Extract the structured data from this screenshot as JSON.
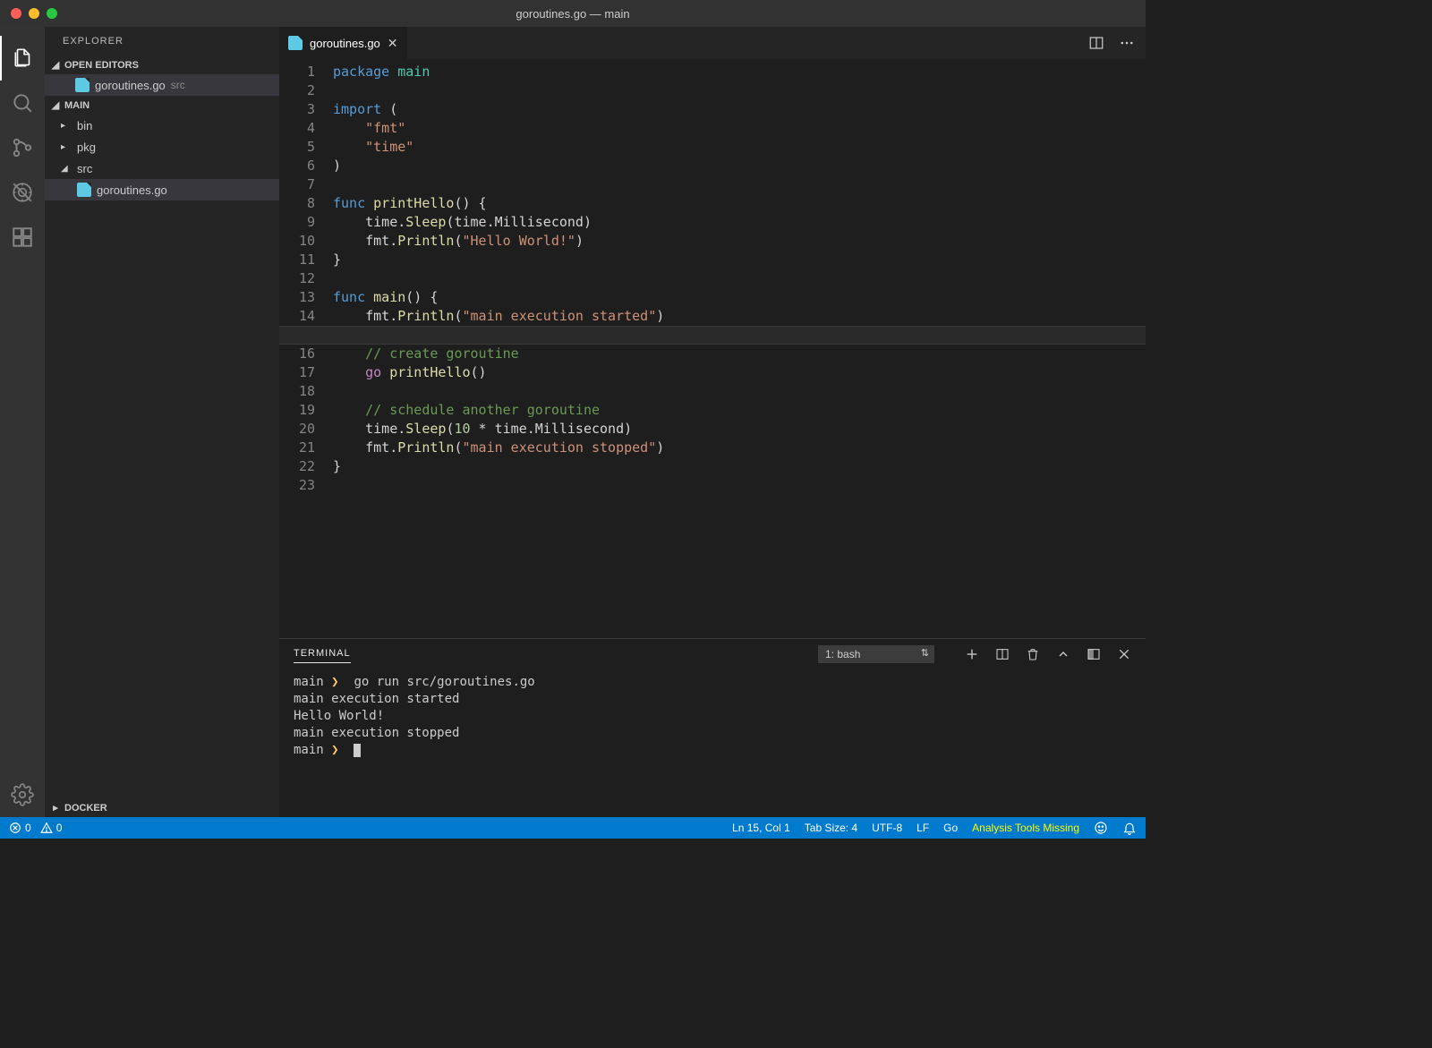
{
  "window": {
    "title": "goroutines.go — main"
  },
  "sidebar": {
    "title": "EXPLORER",
    "open_editors_label": "OPEN EDITORS",
    "open_editors": [
      {
        "name": "goroutines.go",
        "hint": "src"
      }
    ],
    "workspace_label": "MAIN",
    "tree": {
      "bin": "bin",
      "pkg": "pkg",
      "src": "src",
      "file": "goroutines.go"
    },
    "docker_label": "DOCKER"
  },
  "tabs": [
    {
      "name": "goroutines.go"
    }
  ],
  "code": {
    "lines": [
      [
        {
          "c": "kw",
          "t": "package"
        },
        {
          "c": "pl",
          "t": " "
        },
        {
          "c": "pkg",
          "t": "main"
        }
      ],
      [],
      [
        {
          "c": "kw",
          "t": "import"
        },
        {
          "c": "pl",
          "t": " ("
        }
      ],
      [
        {
          "c": "pl",
          "t": "    "
        },
        {
          "c": "str",
          "t": "\"fmt\""
        }
      ],
      [
        {
          "c": "pl",
          "t": "    "
        },
        {
          "c": "str",
          "t": "\"time\""
        }
      ],
      [
        {
          "c": "pl",
          "t": ")"
        }
      ],
      [],
      [
        {
          "c": "kw",
          "t": "func"
        },
        {
          "c": "pl",
          "t": " "
        },
        {
          "c": "fn",
          "t": "printHello"
        },
        {
          "c": "pl",
          "t": "() {"
        }
      ],
      [
        {
          "c": "pl",
          "t": "    time."
        },
        {
          "c": "fn",
          "t": "Sleep"
        },
        {
          "c": "pl",
          "t": "(time.Millisecond)"
        }
      ],
      [
        {
          "c": "pl",
          "t": "    fmt."
        },
        {
          "c": "fn",
          "t": "Println"
        },
        {
          "c": "pl",
          "t": "("
        },
        {
          "c": "str",
          "t": "\"Hello World!\""
        },
        {
          "c": "pl",
          "t": ")"
        }
      ],
      [
        {
          "c": "pl",
          "t": "}"
        }
      ],
      [],
      [
        {
          "c": "kw",
          "t": "func"
        },
        {
          "c": "pl",
          "t": " "
        },
        {
          "c": "fn",
          "t": "main"
        },
        {
          "c": "pl",
          "t": "() {"
        }
      ],
      [
        {
          "c": "pl",
          "t": "    fmt."
        },
        {
          "c": "fn",
          "t": "Println"
        },
        {
          "c": "pl",
          "t": "("
        },
        {
          "c": "str",
          "t": "\"main execution started\""
        },
        {
          "c": "pl",
          "t": ")"
        }
      ],
      [],
      [
        {
          "c": "pl",
          "t": "    "
        },
        {
          "c": "cm",
          "t": "// create goroutine"
        }
      ],
      [
        {
          "c": "pl",
          "t": "    "
        },
        {
          "c": "ctrl",
          "t": "go"
        },
        {
          "c": "pl",
          "t": " "
        },
        {
          "c": "fn",
          "t": "printHello"
        },
        {
          "c": "pl",
          "t": "()"
        }
      ],
      [],
      [
        {
          "c": "pl",
          "t": "    "
        },
        {
          "c": "cm",
          "t": "// schedule another goroutine"
        }
      ],
      [
        {
          "c": "pl",
          "t": "    time."
        },
        {
          "c": "fn",
          "t": "Sleep"
        },
        {
          "c": "pl",
          "t": "("
        },
        {
          "c": "num",
          "t": "10"
        },
        {
          "c": "pl",
          "t": " * time.Millisecond)"
        }
      ],
      [
        {
          "c": "pl",
          "t": "    fmt."
        },
        {
          "c": "fn",
          "t": "Println"
        },
        {
          "c": "pl",
          "t": "("
        },
        {
          "c": "str",
          "t": "\"main execution stopped\""
        },
        {
          "c": "pl",
          "t": ")"
        }
      ],
      [
        {
          "c": "pl",
          "t": "}"
        }
      ],
      []
    ],
    "highlight_line": 15
  },
  "terminal": {
    "tab_label": "TERMINAL",
    "select_label": "1: bash",
    "lines": [
      {
        "prompt": "main",
        "cmd": "go run src/goroutines.go"
      },
      {
        "out": "main execution started"
      },
      {
        "out": "Hello World!"
      },
      {
        "out": "main execution stopped"
      },
      {
        "prompt": "main",
        "cursor": true
      }
    ]
  },
  "status": {
    "errors": "0",
    "warnings": "0",
    "cursor": "Ln 15, Col 1",
    "tab": "Tab Size: 4",
    "encoding": "UTF-8",
    "eol": "LF",
    "lang": "Go",
    "analysis": "Analysis Tools Missing"
  }
}
